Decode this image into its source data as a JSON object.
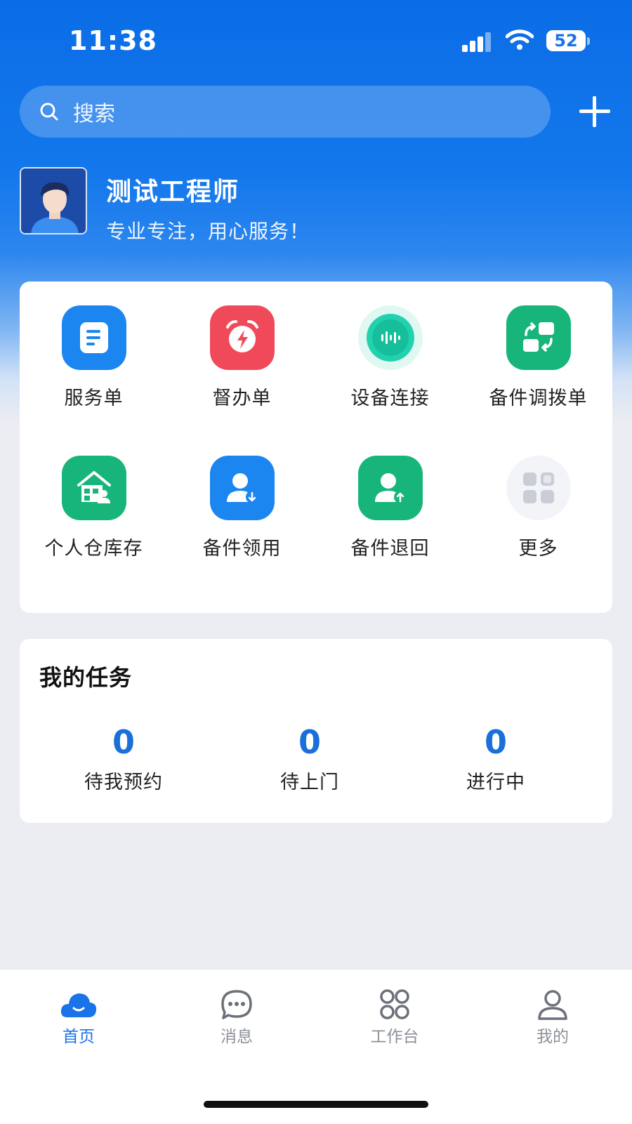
{
  "status_bar": {
    "time": "11:38",
    "battery": "52"
  },
  "search": {
    "placeholder": "搜索"
  },
  "profile": {
    "name": "测试工程师",
    "slogan": "专业专注，用心服务！"
  },
  "shortcuts": [
    {
      "label": "服务单",
      "icon": "service-order-icon",
      "color": "#1C86F0"
    },
    {
      "label": "督办单",
      "icon": "alarm-clock-icon",
      "color": "#F04A5A"
    },
    {
      "label": "设备连接",
      "icon": "device-connect-icon",
      "color": "#1CC9A6"
    },
    {
      "label": "备件调拨单",
      "icon": "transfer-icon",
      "color": "#17B57A"
    },
    {
      "label": "个人仓库存",
      "icon": "warehouse-icon",
      "color": "#17B57A"
    },
    {
      "label": "备件领用",
      "icon": "receive-parts-icon",
      "color": "#1C86F0"
    },
    {
      "label": "备件退回",
      "icon": "return-parts-icon",
      "color": "#17B57A"
    },
    {
      "label": "更多",
      "icon": "more-apps-icon",
      "color": "#C9CDD6"
    }
  ],
  "tasks": {
    "title": "我的任务",
    "stats": [
      {
        "count": "0",
        "label": "待我预约"
      },
      {
        "count": "0",
        "label": "待上门"
      },
      {
        "count": "0",
        "label": "进行中"
      }
    ]
  },
  "tab_bar": {
    "items": [
      {
        "label": "首页",
        "icon": "home-cloud-icon",
        "active": true
      },
      {
        "label": "消息",
        "icon": "chat-bubble-icon",
        "active": false
      },
      {
        "label": "工作台",
        "icon": "workbench-icon",
        "active": false
      },
      {
        "label": "我的",
        "icon": "profile-icon",
        "active": false
      }
    ]
  },
  "colors": {
    "brand_blue": "#1A73E8",
    "count_blue": "#1A6FD8",
    "page_bg": "#EBEDF2"
  }
}
